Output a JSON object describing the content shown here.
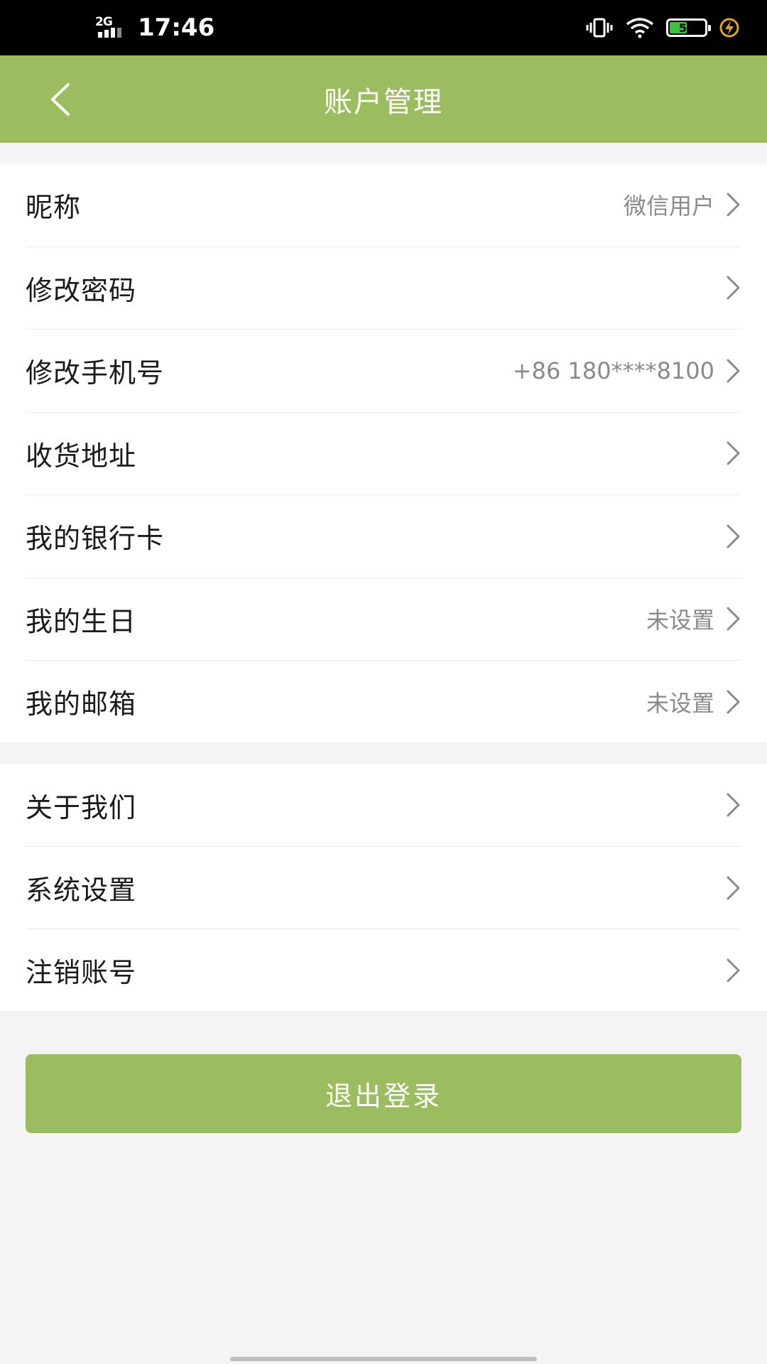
{
  "status_bar": {
    "network": "2G",
    "time": "17:46",
    "battery": "51"
  },
  "header": {
    "title": "账户管理"
  },
  "account_items": [
    {
      "label": "昵称",
      "value": "微信用户"
    },
    {
      "label": "修改密码",
      "value": ""
    },
    {
      "label": "修改手机号",
      "value": "+86 180****8100"
    },
    {
      "label": "收货地址",
      "value": ""
    },
    {
      "label": "我的银行卡",
      "value": ""
    },
    {
      "label": "我的生日",
      "value": "未设置"
    },
    {
      "label": "我的邮箱",
      "value": "未设置"
    }
  ],
  "other_items": [
    {
      "label": "关于我们"
    },
    {
      "label": "系统设置"
    },
    {
      "label": "注销账号"
    }
  ],
  "logout_label": "退出登录",
  "colors": {
    "theme_green": "#9bbc5f",
    "background": "#f4f4f4",
    "value_gray": "#8a8a8a"
  },
  "icons": {
    "back": "chevron-left-icon",
    "row_arrow": "chevron-right-icon"
  }
}
